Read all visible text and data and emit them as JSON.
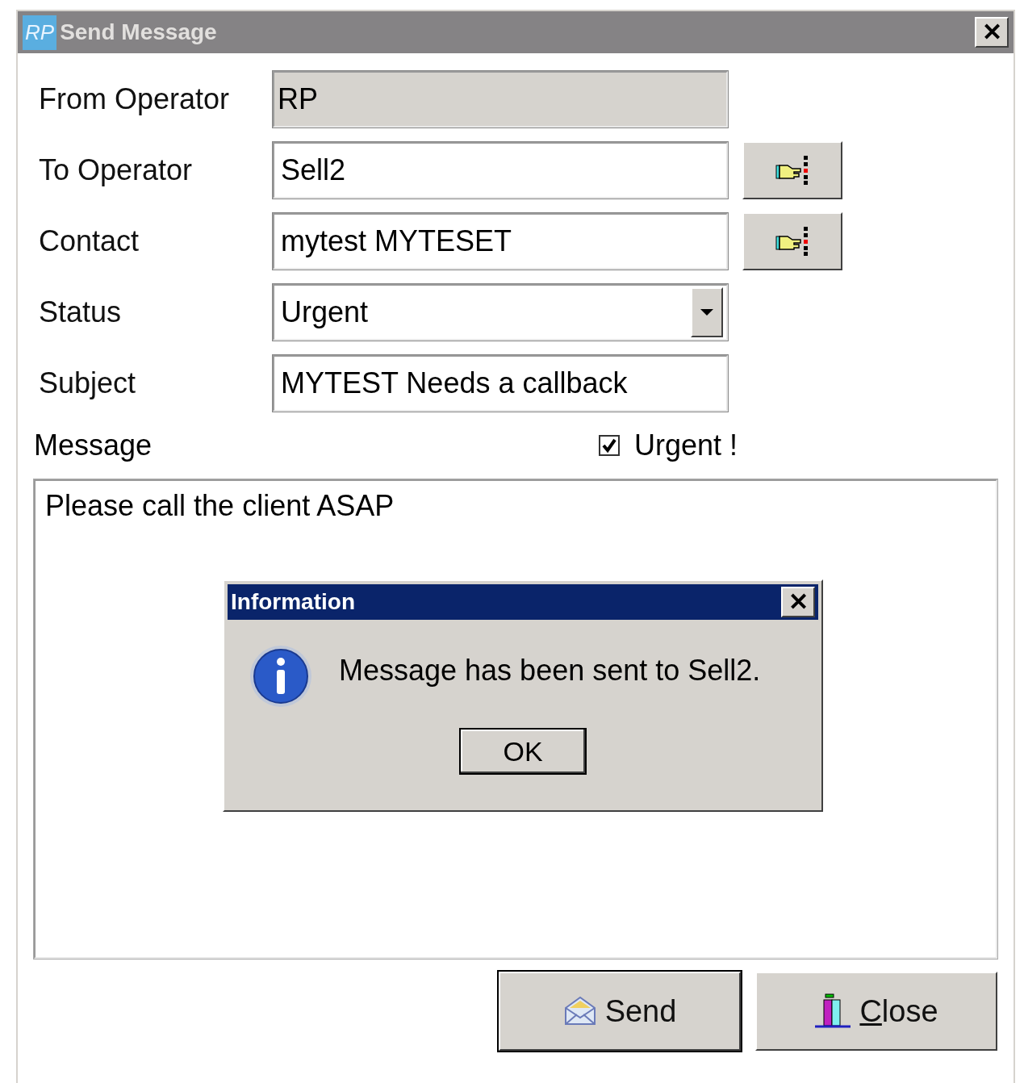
{
  "window": {
    "app_badge": "RP",
    "title": "Send Message",
    "close": "✕"
  },
  "fields": [
    {
      "label": "From Operator",
      "kind": "readonly",
      "value": "RP",
      "picker": false
    },
    {
      "label": "To Operator",
      "kind": "text",
      "value": "Sell2",
      "picker": true
    },
    {
      "label": "Contact",
      "kind": "text",
      "value": "mytest MYTESET",
      "picker": true
    },
    {
      "label": "Status",
      "kind": "dropdown",
      "value": "Urgent",
      "picker": false
    },
    {
      "label": "Subject",
      "kind": "text",
      "value": "MYTEST Needs a callback",
      "picker": false
    }
  ],
  "message": {
    "label": "Message",
    "urgent": {
      "label": "Urgent !",
      "checked": true
    },
    "body": "Please call the client ASAP"
  },
  "info_dialog": {
    "title": "Information",
    "close": "✕",
    "text": "Message has been sent to Sell2.",
    "button": "OK"
  },
  "buttons": [
    {
      "kind": "send",
      "label": "Send",
      "underline_first": false
    },
    {
      "kind": "close",
      "label": "Close",
      "underline_first": true
    }
  ]
}
